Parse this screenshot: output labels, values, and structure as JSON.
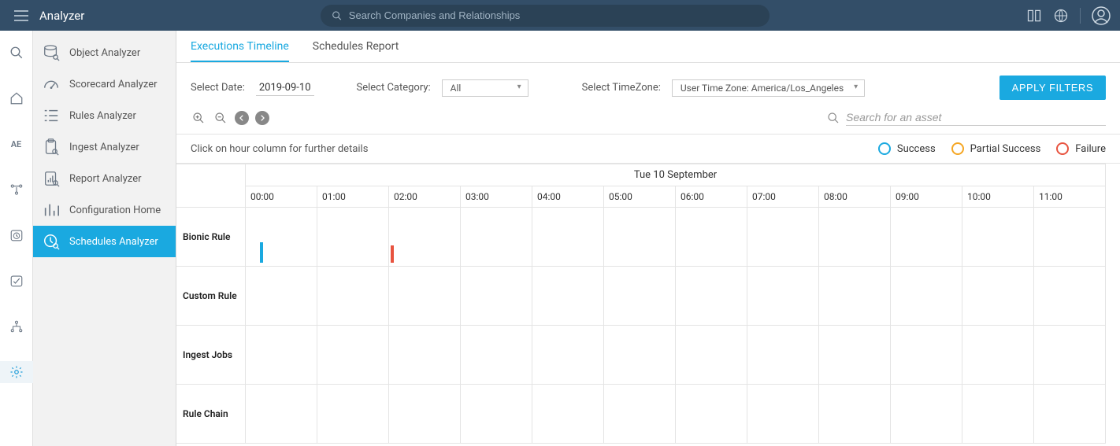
{
  "header": {
    "title": "Analyzer",
    "search_placeholder": "Search Companies and Relationships"
  },
  "iconrail": {
    "text_item": "AE"
  },
  "sidebar": {
    "items": [
      {
        "label": "Object Analyzer"
      },
      {
        "label": "Scorecard Analyzer"
      },
      {
        "label": "Rules Analyzer"
      },
      {
        "label": "Ingest Analyzer"
      },
      {
        "label": "Report Analyzer"
      },
      {
        "label": "Configuration Home"
      },
      {
        "label": "Schedules Analyzer"
      }
    ]
  },
  "tabs": {
    "executions": "Executions Timeline",
    "schedules": "Schedules Report"
  },
  "filters": {
    "date_label": "Select Date:",
    "date_value": "2019-09-10",
    "category_label": "Select Category:",
    "category_value": "All",
    "tz_label": "Select TimeZone:",
    "tz_value": "User Time Zone: America/Los_Angeles",
    "apply_label": "APPLY FILTERS"
  },
  "toolbar": {
    "asset_search_placeholder": "Search for an asset"
  },
  "hint": {
    "text": "Click on hour column for further details",
    "legend": {
      "success": "Success",
      "partial": "Partial Success",
      "failure": "Failure"
    }
  },
  "timeline": {
    "date_header": "Tue 10 September",
    "hours": [
      "00:00",
      "01:00",
      "02:00",
      "03:00",
      "04:00",
      "05:00",
      "06:00",
      "07:00",
      "08:00",
      "09:00",
      "10:00",
      "11:00"
    ],
    "rows": [
      "Bionic Rule",
      "Custom Rule",
      "Ingest Jobs",
      "Rule Chain"
    ]
  },
  "colors": {
    "success": "#1aa9e0",
    "partial": "#f5a623",
    "failure": "#e8533f"
  }
}
